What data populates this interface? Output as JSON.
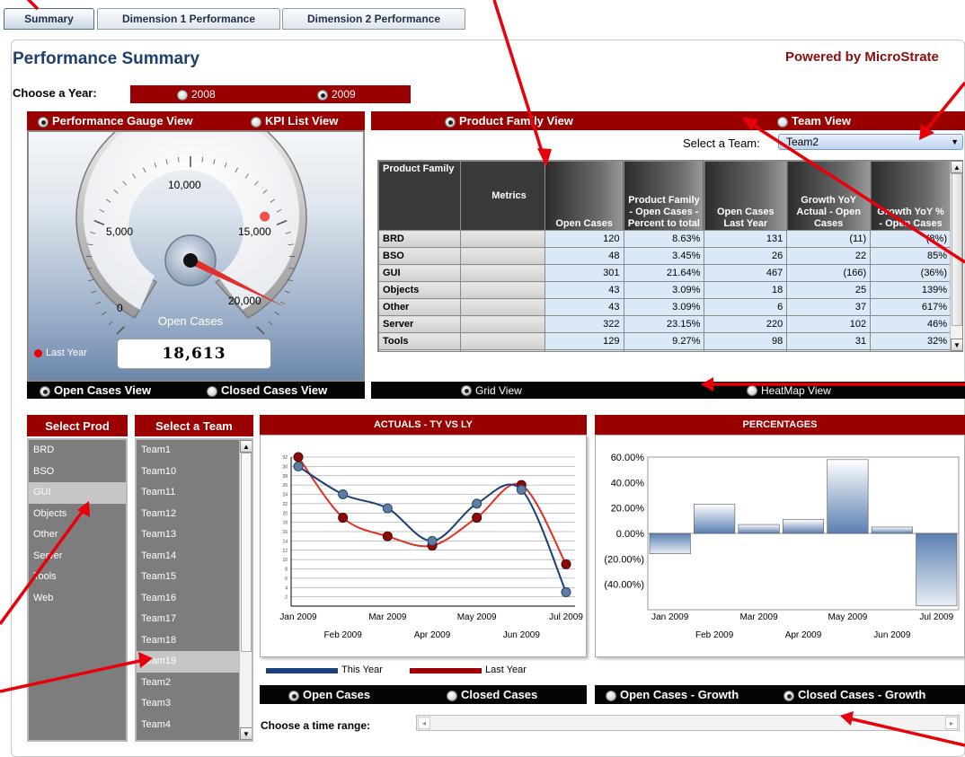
{
  "tabs": [
    {
      "label": "Summary",
      "active": true
    },
    {
      "label": "Dimension 1 Performance",
      "active": false
    },
    {
      "label": "Dimension 2 Performance",
      "active": false
    }
  ],
  "header": {
    "title": "Performance Summary",
    "powered_by": "Powered by MicroStrate"
  },
  "year": {
    "label": "Choose a Year:",
    "options": [
      "2008",
      "2009"
    ],
    "selected": "2009"
  },
  "gauge_panel": {
    "view_options": [
      "Performance Gauge View",
      "KPI List View"
    ],
    "selected_view": "Performance Gauge View",
    "ticks": [
      "0",
      "5,000",
      "10,000",
      "15,000",
      "20,000"
    ],
    "gauge_label": "Open Cases",
    "value": "18,613",
    "gauge_value": 18613,
    "gauge_max": 20000,
    "last_year_label": "Last Year",
    "last_year_value_fraction": 0.72,
    "footer_options": [
      "Open Cases View",
      "Closed Cases View"
    ],
    "footer_selected": "Open Cases View",
    "accent_color": "#9b0000"
  },
  "grid_panel": {
    "view_options": [
      "Product Family View",
      "Team View"
    ],
    "selected_view": "Product Family View",
    "team_label": "Select a Team:",
    "team_value": "Team2",
    "columns": [
      "Product Family",
      "Metrics",
      "Open Cases",
      "Product Family - Open Cases - Percent to total",
      "Open Cases Last Year",
      "Growth YoY Actual - Open Cases",
      "Growth YoY % - Open Cases"
    ],
    "rows": [
      {
        "name": "BRD",
        "values": [
          "120",
          "8.63%",
          "131",
          "(11)",
          "(8%)"
        ]
      },
      {
        "name": "BSO",
        "values": [
          "48",
          "3.45%",
          "26",
          "22",
          "85%"
        ]
      },
      {
        "name": "GUI",
        "values": [
          "301",
          "21.64%",
          "467",
          "(166)",
          "(36%)"
        ]
      },
      {
        "name": "Objects",
        "values": [
          "43",
          "3.09%",
          "18",
          "25",
          "139%"
        ]
      },
      {
        "name": "Other",
        "values": [
          "43",
          "3.09%",
          "6",
          "37",
          "617%"
        ]
      },
      {
        "name": "Server",
        "values": [
          "322",
          "23.15%",
          "220",
          "102",
          "46%"
        ]
      },
      {
        "name": "Tools",
        "values": [
          "129",
          "9.27%",
          "98",
          "31",
          "32%"
        ]
      }
    ],
    "footer_options": [
      "Grid View",
      "HeatMap View"
    ],
    "footer_selected": "Grid View"
  },
  "select_prod": {
    "title": "Select Prod",
    "items": [
      "BRD",
      "BSO",
      "GUI",
      "Objects",
      "Other",
      "Server",
      "Tools",
      "Web"
    ],
    "selected": "GUI"
  },
  "select_team": {
    "title": "Select a Team",
    "items": [
      "Team1",
      "Team10",
      "Team11",
      "Team12",
      "Team13",
      "Team14",
      "Team15",
      "Team16",
      "Team17",
      "Team18",
      "Team19",
      "Team2",
      "Team3",
      "Team4"
    ],
    "selected": "Team19"
  },
  "actuals_chart": {
    "title": "ACTUALS - TY VS LY",
    "legend": [
      "This Year",
      "Last Year"
    ],
    "footer_options": [
      "Open Cases",
      "Closed Cases"
    ],
    "footer_selected": "Open Cases"
  },
  "percent_chart": {
    "title": "PERCENTAGES",
    "footer_options": [
      "Open Cases - Growth",
      "Closed Cases - Growth"
    ],
    "footer_selected": "Closed Cases - Growth"
  },
  "time_range_label": "Choose a time range:",
  "chart_data": [
    {
      "type": "line",
      "title": "ACTUALS - TY VS LY",
      "x": [
        "Jan 2009",
        "Feb 2009",
        "Mar 2009",
        "Apr 2009",
        "May 2009",
        "Jun 2009",
        "Jul 2009"
      ],
      "ylim": [
        0,
        32
      ],
      "yticks": [
        "2",
        "4",
        "6",
        "8",
        "10",
        "12",
        "14",
        "16",
        "18",
        "20",
        "22",
        "24",
        "26",
        "28",
        "30",
        "32"
      ],
      "series": [
        {
          "name": "This Year",
          "color": "#1a3f7a",
          "values": [
            30,
            24,
            21,
            14,
            22,
            25,
            3
          ]
        },
        {
          "name": "Last Year",
          "color": "#e03020",
          "values": [
            32,
            19,
            15,
            13,
            19,
            26,
            9
          ]
        }
      ]
    },
    {
      "type": "bar",
      "title": "PERCENTAGES",
      "categories": [
        "Jan 2009",
        "Feb 2009",
        "Mar 2009",
        "Apr 2009",
        "May 2009",
        "Jun 2009",
        "Jul 2009"
      ],
      "values": [
        -16,
        23,
        7,
        11,
        58,
        5,
        -57
      ],
      "ylim": [
        -60,
        60
      ],
      "yticks": [
        "60.00%",
        "40.00%",
        "20.00%",
        "0.00%",
        "(20.00%)",
        "(40.00%)"
      ]
    }
  ]
}
